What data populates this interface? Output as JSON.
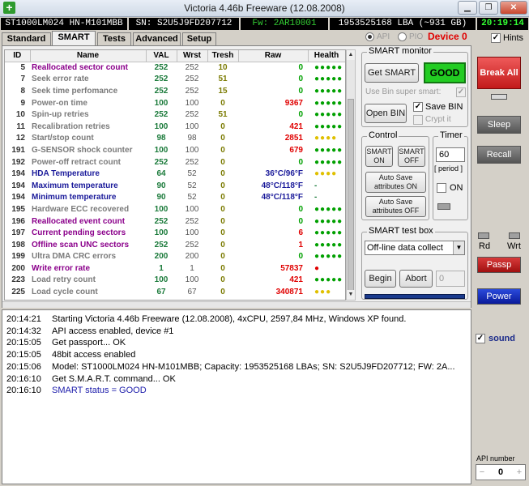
{
  "window": {
    "title": "Victoria 4.46b Freeware (12.08.2008)",
    "icon_glyph": "+",
    "min_glyph": "▁",
    "max_glyph": "❐",
    "close_glyph": "✕"
  },
  "info": {
    "model": "ST1000LM024 HN-M101MBB",
    "serial": "SN: S2U5J9FD207712",
    "firmware": "Fw: 2AR10001",
    "lba": "1953525168 LBA (~931 GB)",
    "time": "20:19:14"
  },
  "tabs": [
    {
      "label": "Standard"
    },
    {
      "label": "SMART"
    },
    {
      "label": "Tests"
    },
    {
      "label": "Advanced"
    },
    {
      "label": "Setup"
    }
  ],
  "mode": {
    "api_label": "API",
    "pio_label": "PIO",
    "device_label": "Device 0"
  },
  "hints": {
    "label": "Hints",
    "check": "✓"
  },
  "table": {
    "headers": [
      "ID",
      "Name",
      "VAL",
      "Wrst",
      "Tresh",
      "Raw",
      "Health"
    ],
    "rows": [
      {
        "id": "5",
        "name": "Reallocated sector count",
        "val": "252",
        "wrst": "252",
        "tresh": "10",
        "raw": "0",
        "health": "●●●●●",
        "name_color": "#8b008b",
        "val_color": "#1a7a3a",
        "tresh_color": "#7a7a00",
        "raw_color": "#00a000",
        "health_color": "#00a000"
      },
      {
        "id": "7",
        "name": "Seek error rate",
        "val": "252",
        "wrst": "252",
        "tresh": "51",
        "raw": "0",
        "health": "●●●●●",
        "name_color": "#7a7a7a",
        "val_color": "#1a7a3a",
        "tresh_color": "#7a7a00",
        "raw_color": "#00a000",
        "health_color": "#00a000"
      },
      {
        "id": "8",
        "name": "Seek time perfomance",
        "val": "252",
        "wrst": "252",
        "tresh": "15",
        "raw": "0",
        "health": "●●●●●",
        "name_color": "#7a7a7a",
        "val_color": "#1a7a3a",
        "tresh_color": "#7a7a00",
        "raw_color": "#00a000",
        "health_color": "#00a000"
      },
      {
        "id": "9",
        "name": "Power-on time",
        "val": "100",
        "wrst": "100",
        "tresh": "0",
        "raw": "9367",
        "health": "●●●●●",
        "name_color": "#7a7a7a",
        "val_color": "#1a7a3a",
        "tresh_color": "#7a7a00",
        "raw_color": "#e00000",
        "health_color": "#00a000"
      },
      {
        "id": "10",
        "name": "Spin-up retries",
        "val": "252",
        "wrst": "252",
        "tresh": "51",
        "raw": "0",
        "health": "●●●●●",
        "name_color": "#7a7a7a",
        "val_color": "#1a7a3a",
        "tresh_color": "#7a7a00",
        "raw_color": "#00a000",
        "health_color": "#00a000"
      },
      {
        "id": "11",
        "name": "Recalibration retries",
        "val": "100",
        "wrst": "100",
        "tresh": "0",
        "raw": "421",
        "health": "●●●●●",
        "name_color": "#7a7a7a",
        "val_color": "#1a7a3a",
        "tresh_color": "#7a7a00",
        "raw_color": "#e00000",
        "health_color": "#00a000"
      },
      {
        "id": "12",
        "name": "Start/stop count",
        "val": "98",
        "wrst": "98",
        "tresh": "0",
        "raw": "2851",
        "health": "●●●●",
        "name_color": "#7a7a7a",
        "val_color": "#1a7a3a",
        "tresh_color": "#7a7a00",
        "raw_color": "#e00000",
        "health_color": "#e0c000"
      },
      {
        "id": "191",
        "name": "G-SENSOR shock counter",
        "val": "100",
        "wrst": "100",
        "tresh": "0",
        "raw": "679",
        "health": "●●●●●",
        "name_color": "#7a7a7a",
        "val_color": "#1a7a3a",
        "tresh_color": "#7a7a00",
        "raw_color": "#e00000",
        "health_color": "#00a000"
      },
      {
        "id": "192",
        "name": "Power-off retract count",
        "val": "252",
        "wrst": "252",
        "tresh": "0",
        "raw": "0",
        "health": "●●●●●",
        "name_color": "#7a7a7a",
        "val_color": "#1a7a3a",
        "tresh_color": "#7a7a00",
        "raw_color": "#00a000",
        "health_color": "#00a000"
      },
      {
        "id": "194",
        "name": "HDA Temperature",
        "val": "64",
        "wrst": "52",
        "tresh": "0",
        "raw": "36°C/96°F",
        "health": "●●●●",
        "name_color": "#1a1a9a",
        "val_color": "#1a7a3a",
        "tresh_color": "#7a7a00",
        "raw_color": "#1a1a9a",
        "health_color": "#e0c000"
      },
      {
        "id": "194",
        "name": "Maximum temperature",
        "val": "90",
        "wrst": "52",
        "tresh": "0",
        "raw": "48°C/118°F",
        "health": "-",
        "name_color": "#1a1a9a",
        "val_color": "#1a7a3a",
        "tresh_color": "#7a7a00",
        "raw_color": "#1a1a9a",
        "health_color": "#1a7a3a"
      },
      {
        "id": "194",
        "name": "Minimum temperature",
        "val": "90",
        "wrst": "52",
        "tresh": "0",
        "raw": "48°C/118°F",
        "health": "-",
        "name_color": "#1a1a9a",
        "val_color": "#1a7a3a",
        "tresh_color": "#7a7a00",
        "raw_color": "#1a1a9a",
        "health_color": "#1a7a3a"
      },
      {
        "id": "195",
        "name": "Hardware ECC recovered",
        "val": "100",
        "wrst": "100",
        "tresh": "0",
        "raw": "0",
        "health": "●●●●●",
        "name_color": "#7a7a7a",
        "val_color": "#1a7a3a",
        "tresh_color": "#7a7a00",
        "raw_color": "#00a000",
        "health_color": "#00a000"
      },
      {
        "id": "196",
        "name": "Reallocated event count",
        "val": "252",
        "wrst": "252",
        "tresh": "0",
        "raw": "0",
        "health": "●●●●●",
        "name_color": "#8b008b",
        "val_color": "#1a7a3a",
        "tresh_color": "#7a7a00",
        "raw_color": "#00a000",
        "health_color": "#00a000"
      },
      {
        "id": "197",
        "name": "Current pending sectors",
        "val": "100",
        "wrst": "100",
        "tresh": "0",
        "raw": "6",
        "health": "●●●●●",
        "name_color": "#8b008b",
        "val_color": "#1a7a3a",
        "tresh_color": "#7a7a00",
        "raw_color": "#e00000",
        "health_color": "#00a000"
      },
      {
        "id": "198",
        "name": "Offline scan UNC sectors",
        "val": "252",
        "wrst": "252",
        "tresh": "0",
        "raw": "1",
        "health": "●●●●●",
        "name_color": "#8b008b",
        "val_color": "#1a7a3a",
        "tresh_color": "#7a7a00",
        "raw_color": "#e00000",
        "health_color": "#00a000"
      },
      {
        "id": "199",
        "name": "Ultra DMA CRC errors",
        "val": "200",
        "wrst": "200",
        "tresh": "0",
        "raw": "0",
        "health": "●●●●●",
        "name_color": "#7a7a7a",
        "val_color": "#1a7a3a",
        "tresh_color": "#7a7a00",
        "raw_color": "#00a000",
        "health_color": "#00a000"
      },
      {
        "id": "200",
        "name": "Write error rate",
        "val": "1",
        "wrst": "1",
        "tresh": "0",
        "raw": "57837",
        "health": "●",
        "name_color": "#8b008b",
        "val_color": "#1a7a3a",
        "tresh_color": "#7a7a00",
        "raw_color": "#e00000",
        "health_color": "#e00000"
      },
      {
        "id": "223",
        "name": "Load retry count",
        "val": "100",
        "wrst": "100",
        "tresh": "0",
        "raw": "421",
        "health": "●●●●●",
        "name_color": "#7a7a7a",
        "val_color": "#1a7a3a",
        "tresh_color": "#7a7a00",
        "raw_color": "#e00000",
        "health_color": "#00a000"
      },
      {
        "id": "225",
        "name": "Load cycle count",
        "val": "67",
        "wrst": "67",
        "tresh": "0",
        "raw": "340871",
        "health": "●●●",
        "name_color": "#7a7a7a",
        "val_color": "#1a7a3a",
        "tresh_color": "#7a7a00",
        "raw_color": "#e00000",
        "health_color": "#e0c000"
      }
    ]
  },
  "smart_monitor": {
    "title": "SMART monitor",
    "get_smart_label": "Get SMART",
    "status": "GOOD",
    "use_bin_label": "Use Bin super smart:",
    "use_bin_check": "✓",
    "open_bin_label": "Open BIN",
    "save_bin_label": "Save BIN",
    "save_bin_check": "✓",
    "crypt_label": "Crypt it"
  },
  "control": {
    "title": "Control",
    "smart_on": "SMART ON",
    "smart_off": "SMART OFF",
    "autosave_on": "Auto Save attributes ON",
    "autosave_off": "Auto Save attributes OFF"
  },
  "timer": {
    "title": "Timer",
    "value": "60",
    "period_label": "[ period ]",
    "on_label": "ON"
  },
  "test_box": {
    "title": "SMART test box",
    "selected": "Off-line data collect",
    "arrow": "▼",
    "begin_label": "Begin",
    "abort_label": "Abort",
    "counter": "0"
  },
  "scroll": {
    "up": "▲",
    "down": "▼"
  },
  "log": [
    {
      "time": "20:14:21",
      "text": "Starting Victoria 4.46b Freeware (12.08.2008), 4xCPU, 2597,84 MHz, Windows XP found.",
      "color": "#000000"
    },
    {
      "time": "20:14:32",
      "text": "API access enabled, device #1",
      "color": "#000000"
    },
    {
      "time": "20:15:05",
      "text": "Get passport... OK",
      "color": "#000000"
    },
    {
      "time": "20:15:05",
      "text": "48bit access enabled",
      "color": "#000000"
    },
    {
      "time": "20:15:06",
      "text": "Model: ST1000LM024 HN-M101MBB; Capacity: 1953525168 LBAs; SN: S2U5J9FD207712; FW: 2A...",
      "color": "#000000"
    },
    {
      "time": "20:16:10",
      "text": "Get S.M.A.R.T. command... OK",
      "color": "#000000"
    },
    {
      "time": "20:16:10",
      "text": "SMART status = GOOD",
      "color": "#1a1aaa"
    }
  ],
  "side": {
    "break_all": "Break All",
    "sleep": "Sleep",
    "recall": "Recall",
    "rd": "Rd",
    "wrt": "Wrt",
    "passp": "Passp",
    "power": "Power",
    "sound_label": "sound",
    "sound_check": "✓",
    "api_number_label": "API number",
    "api_minus": "−",
    "api_plus": "+",
    "api_number": "0"
  }
}
